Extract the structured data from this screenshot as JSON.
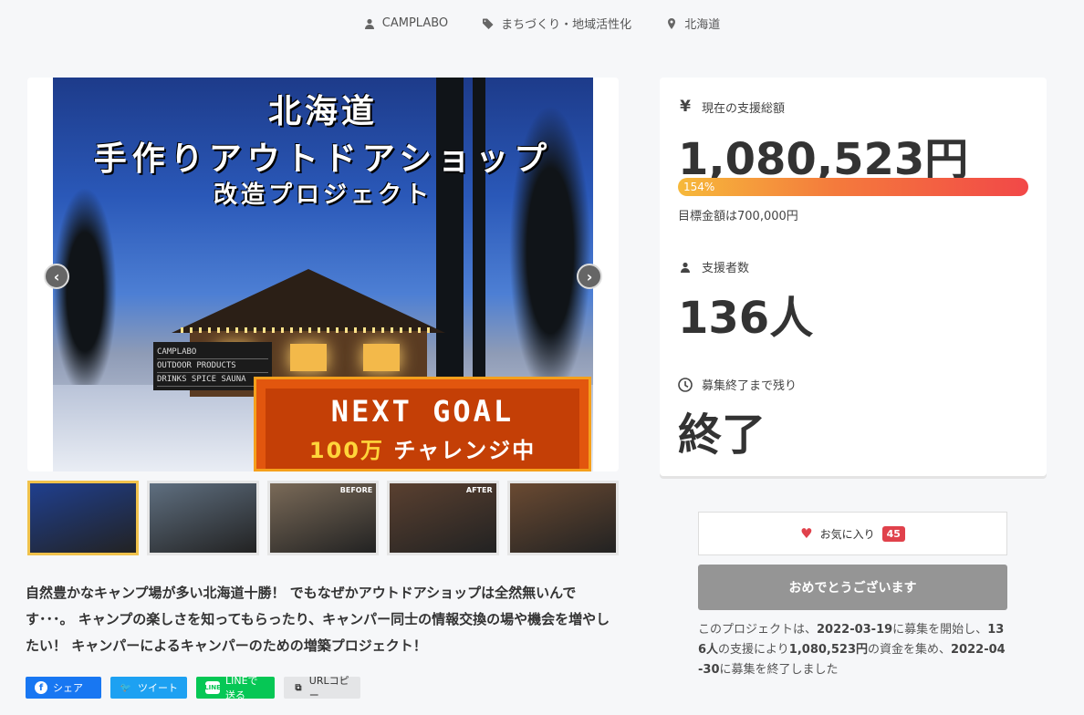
{
  "meta": {
    "owner": "CAMPLABO",
    "category": "まちづくり・地域活性化",
    "location": "北海道"
  },
  "hero": {
    "title_line1": "北海道",
    "title_line2": "手作りアウトドアショップ",
    "title_line3": "改造プロジェクト",
    "sign_lines": [
      "CAMPLABO",
      "OUTDOOR PRODUCTS",
      "DRINKS SPICE SAUNA"
    ],
    "goal_line1": "NEXT GOAL",
    "goal_line2_highlight": "100万",
    "goal_line2_rest": "チャレンジ中"
  },
  "thumbnails": [
    {
      "label": "",
      "active": true,
      "color": "#1f3f8f"
    },
    {
      "label": "",
      "active": false,
      "color": "#5f6f80"
    },
    {
      "label": "BEFORE",
      "active": false,
      "color": "#7a6a58"
    },
    {
      "label": "AFTER",
      "active": false,
      "color": "#5a4030"
    },
    {
      "label": "",
      "active": false,
      "color": "#6a4a32"
    }
  ],
  "description": "自然豊かなキャンプ場が多い北海道十勝！ でもなぜかアウトドアショップは全然無いんです･･･。 キャンプの楽しさを知ってもらったり、キャンパー同士の情報交換の場や機会を増やしたい！ キャンパーによるキャンパーのための増築プロジェクト！",
  "share": {
    "facebook": "シェア",
    "twitter": "ツイート",
    "line": "LINEで送る",
    "url": "URLコピー"
  },
  "stats": {
    "total_label": "現在の支援総額",
    "total_value": "1,080,523円",
    "progress_text": "154%",
    "progress_percent": 154,
    "goal_text": "目標金額は700,000円",
    "supporters_label": "支援者数",
    "supporters_value": "136人",
    "remaining_label": "募集終了まで残り",
    "remaining_value": "終了"
  },
  "favorite": {
    "label": "お気に入り",
    "count": "45"
  },
  "congrats_button": "おめでとうございます",
  "summary": {
    "p1": "このプロジェクトは、",
    "start_date": "2022-03-19",
    "p2": "に募集を開始し、",
    "supporters": "136人",
    "p3": "の支援により",
    "amount": "1,080,523円",
    "p4": "の資金を集め、",
    "end_date": "2022-04-30",
    "p5": "に募集を終了しました"
  },
  "colors": {
    "accent_red": "#e0414b",
    "progress_start": "#f6b93b",
    "progress_end": "#f24848",
    "facebook": "#1877f2",
    "twitter": "#1da1f2",
    "line": "#06c755"
  }
}
